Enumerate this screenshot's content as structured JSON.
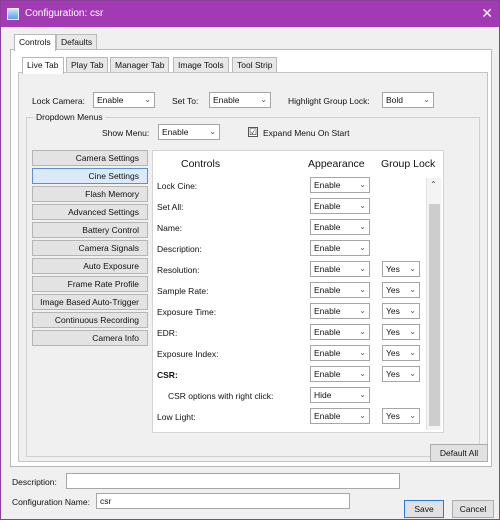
{
  "window": {
    "title": "Configuration: csr",
    "close_glyph": "✕",
    "icon": "app-window-icon"
  },
  "outer_tabs": [
    {
      "label": "Controls"
    },
    {
      "label": "Defaults"
    }
  ],
  "inner_tabs": [
    {
      "label": "Live Tab"
    },
    {
      "label": "Play Tab"
    },
    {
      "label": "Manager Tab"
    },
    {
      "label": "Image Tools"
    },
    {
      "label": "Tool Strip"
    }
  ],
  "top_row": {
    "lock_camera": {
      "label": "Lock Camera:",
      "value": "Enable"
    },
    "set_to": {
      "label": "Set To:",
      "value": "Enable"
    },
    "highlight": {
      "label": "Highlight Group Lock:",
      "value": "Bold"
    }
  },
  "dropdown_menus": {
    "title": "Dropdown Menus",
    "show_menu": {
      "label": "Show Menu:",
      "value": "Enable"
    },
    "expand": {
      "label": "Expand Menu On Start",
      "checked": "☑"
    }
  },
  "sidebar": [
    {
      "label": "Camera Settings"
    },
    {
      "label": "Cine Settings"
    },
    {
      "label": "Flash Memory"
    },
    {
      "label": "Advanced Settings"
    },
    {
      "label": "Battery Control"
    },
    {
      "label": "Camera Signals"
    },
    {
      "label": "Auto Exposure"
    },
    {
      "label": "Frame Rate Profile"
    },
    {
      "label": "Image Based Auto-Trigger"
    },
    {
      "label": "Continuous Recording"
    },
    {
      "label": "Camera Info"
    }
  ],
  "grid": {
    "headers": {
      "controls": "Controls",
      "appearance": "Appearance",
      "group_lock": "Group Lock"
    },
    "rows": [
      {
        "label": "Lock Cine:",
        "appearance": "Enable",
        "group": ""
      },
      {
        "label": "Set All:",
        "appearance": "Enable",
        "group": ""
      },
      {
        "label": "Name:",
        "appearance": "Enable",
        "group": ""
      },
      {
        "label": "Description:",
        "appearance": "Enable",
        "group": ""
      },
      {
        "label": "Resolution:",
        "appearance": "Enable",
        "group": "Yes"
      },
      {
        "label": "Sample Rate:",
        "appearance": "Enable",
        "group": "Yes"
      },
      {
        "label": "Exposure Time:",
        "appearance": "Enable",
        "group": "Yes"
      },
      {
        "label": "EDR:",
        "appearance": "Enable",
        "group": "Yes"
      },
      {
        "label": "Exposure Index:",
        "appearance": "Enable",
        "group": "Yes"
      },
      {
        "label": "CSR:",
        "appearance": "Enable",
        "group": "Yes"
      },
      {
        "label": "CSR options with right click:",
        "appearance": "Hide",
        "group": ""
      },
      {
        "label": "Low Light:",
        "appearance": "Enable",
        "group": "Yes"
      }
    ],
    "scroll_up": "⌃"
  },
  "dropdown_chevron": "⌄",
  "buttons": {
    "default_all": "Default All",
    "save": "Save",
    "cancel": "Cancel"
  },
  "fields": {
    "description": {
      "label": "Description:",
      "value": ""
    },
    "config_name": {
      "label": "Configuration Name:",
      "value": "csr"
    }
  }
}
